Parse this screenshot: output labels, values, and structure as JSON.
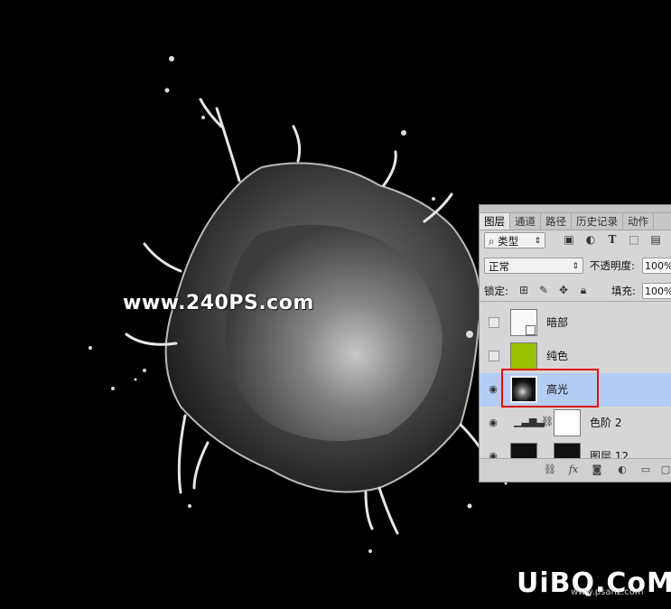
{
  "watermark": "www.240PS.com",
  "logo": {
    "text": "UiBQ.CoM",
    "sub": "www.psahz.com"
  },
  "panel": {
    "tabs": [
      "图层",
      "通道",
      "路径",
      "历史记录",
      "动作"
    ],
    "filter": {
      "label": "类型",
      "icons": [
        "image-filter-icon",
        "adjustment-filter-icon",
        "type-filter-icon",
        "shape-filter-icon",
        "smart-object-filter-icon"
      ]
    },
    "blend_mode": "正常",
    "opacity_label": "不透明度:",
    "opacity_value": "100%",
    "lock_label": "锁定:",
    "fill_label": "填充:",
    "fill_value": "100%",
    "layers": [
      {
        "name": "暗部",
        "visible": false,
        "thumb": "white-smart"
      },
      {
        "name": "纯色",
        "visible": false,
        "thumb": "green",
        "color": "#9bc000"
      },
      {
        "name": "高光",
        "visible": true,
        "thumb": "dark-splash",
        "selected": true
      },
      {
        "name": "色阶 2",
        "visible": true,
        "thumb": "levels-mask"
      },
      {
        "name": "图层 12",
        "visible": true,
        "thumb": "dark"
      }
    ],
    "selection_color": "#b4cdf4",
    "highlight_color": "#e01010"
  }
}
